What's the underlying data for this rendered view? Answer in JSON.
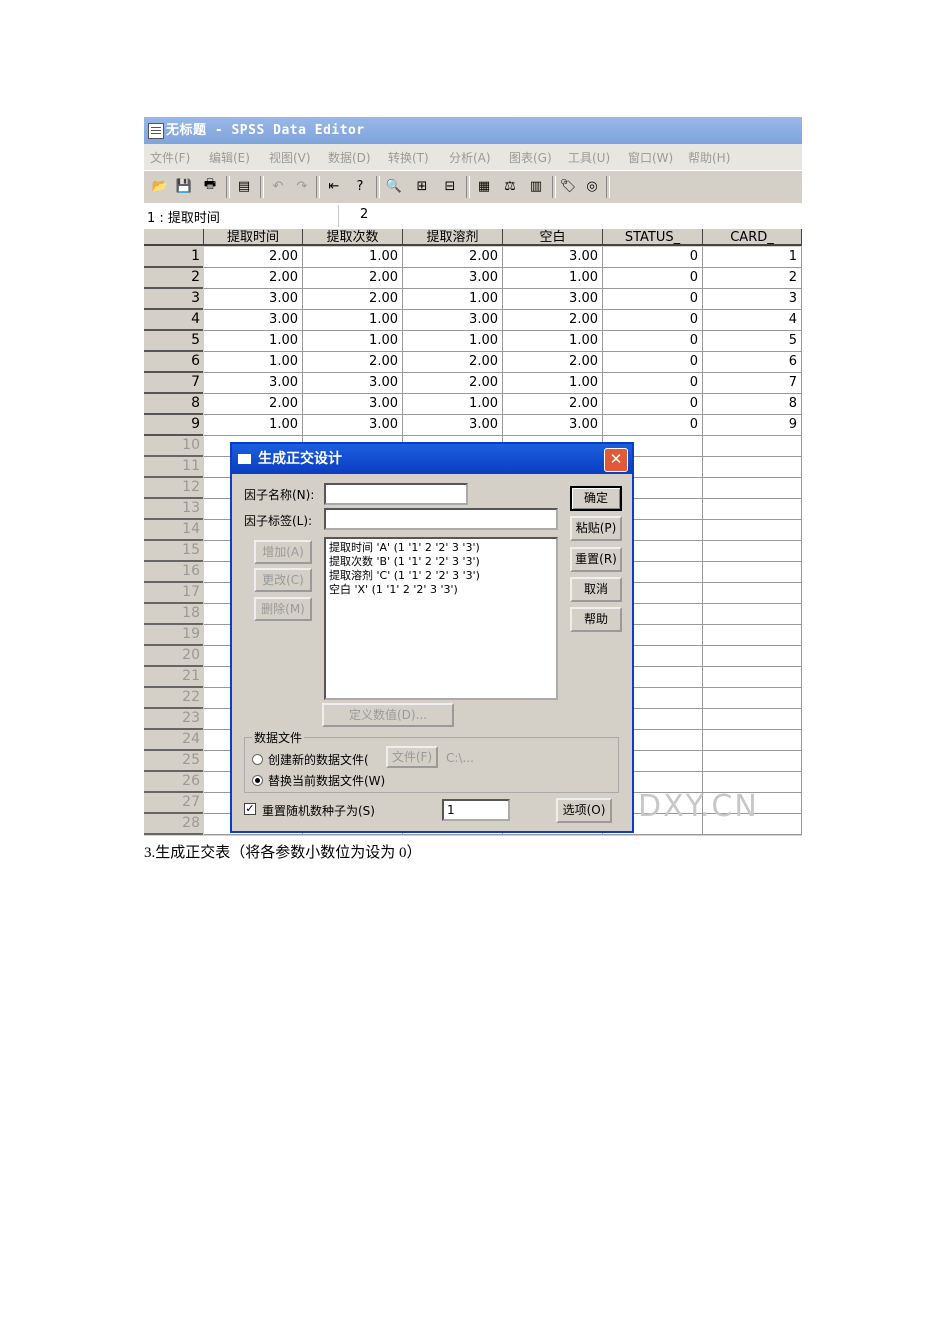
{
  "window": {
    "title": "无标题 - SPSS Data Editor",
    "menus": [
      "文件(F)",
      "编辑(E)",
      "视图(V)",
      "数据(D)",
      "转换(T)",
      "分析(A)",
      "图表(G)",
      "工具(U)",
      "窗口(W)",
      "帮助(H)"
    ],
    "toolbar_icons": [
      "open-icon",
      "save-icon",
      "print-icon",
      "dialog-recall-icon",
      "undo-icon",
      "redo-icon",
      "goto-case-icon",
      "variables-icon",
      "find-icon",
      "insert-cases-icon",
      "insert-variable-icon",
      "split-file-icon",
      "weight-cases-icon",
      "select-cases-icon",
      "value-labels-icon",
      "use-sets-icon"
    ]
  },
  "cell_editor": {
    "ref": "1 : 提取时间",
    "value": "2"
  },
  "grid": {
    "columns": [
      "提取时间",
      "提取次数",
      "提取溶剂",
      "空白",
      "STATUS_",
      "CARD_"
    ],
    "rows": [
      [
        "2.00",
        "1.00",
        "2.00",
        "3.00",
        "0",
        "1"
      ],
      [
        "2.00",
        "2.00",
        "3.00",
        "1.00",
        "0",
        "2"
      ],
      [
        "3.00",
        "2.00",
        "1.00",
        "3.00",
        "0",
        "3"
      ],
      [
        "3.00",
        "1.00",
        "3.00",
        "2.00",
        "0",
        "4"
      ],
      [
        "1.00",
        "1.00",
        "1.00",
        "1.00",
        "0",
        "5"
      ],
      [
        "1.00",
        "2.00",
        "2.00",
        "2.00",
        "0",
        "6"
      ],
      [
        "3.00",
        "3.00",
        "2.00",
        "1.00",
        "0",
        "7"
      ],
      [
        "2.00",
        "3.00",
        "1.00",
        "2.00",
        "0",
        "8"
      ],
      [
        "1.00",
        "3.00",
        "3.00",
        "3.00",
        "0",
        "9"
      ]
    ],
    "row_numbers": [
      "1",
      "2",
      "3",
      "4",
      "5",
      "6",
      "7",
      "8",
      "9",
      "10",
      "11",
      "12",
      "13",
      "14",
      "15",
      "16",
      "17",
      "18",
      "19",
      "20",
      "21",
      "22",
      "23",
      "24",
      "25",
      "26",
      "27",
      "28"
    ]
  },
  "watermark": "DXY.CN",
  "dialog": {
    "title": "生成正交设计",
    "factor_name_label": "因子名称(N):",
    "factor_name_value": "",
    "factor_label_label": "因子标签(L):",
    "factor_label_value": "",
    "add_label": "增加(A)",
    "change_label": "更改(C)",
    "remove_label": "删除(M)",
    "factors": [
      "提取时间 'A' (1 '1' 2 '2' 3 '3')",
      "提取次数 'B' (1 '1' 2 '2' 3 '3')",
      "提取溶剂 'C' (1 '1' 2 '2' 3 '3')",
      "空白 'X' (1 '1' 2 '2' 3 '3')"
    ],
    "define_values_label": "定义数值(D)...",
    "ok_label": "确定",
    "paste_label": "粘贴(P)",
    "reset_label": "重置(R)",
    "cancel_label": "取消",
    "help_label": "帮助",
    "data_file_group": "数据文件",
    "create_new_label": "创建新的数据文件(",
    "file_button_label": "文件(F)",
    "file_path": "C:\\...",
    "replace_label": "替换当前数据文件(W)",
    "reset_seed_label": "重置随机数种子为(S)",
    "seed_value": "1",
    "options_label": "选项(O)"
  },
  "caption": "3.生成正交表（将各参数小数位为设为 0）"
}
